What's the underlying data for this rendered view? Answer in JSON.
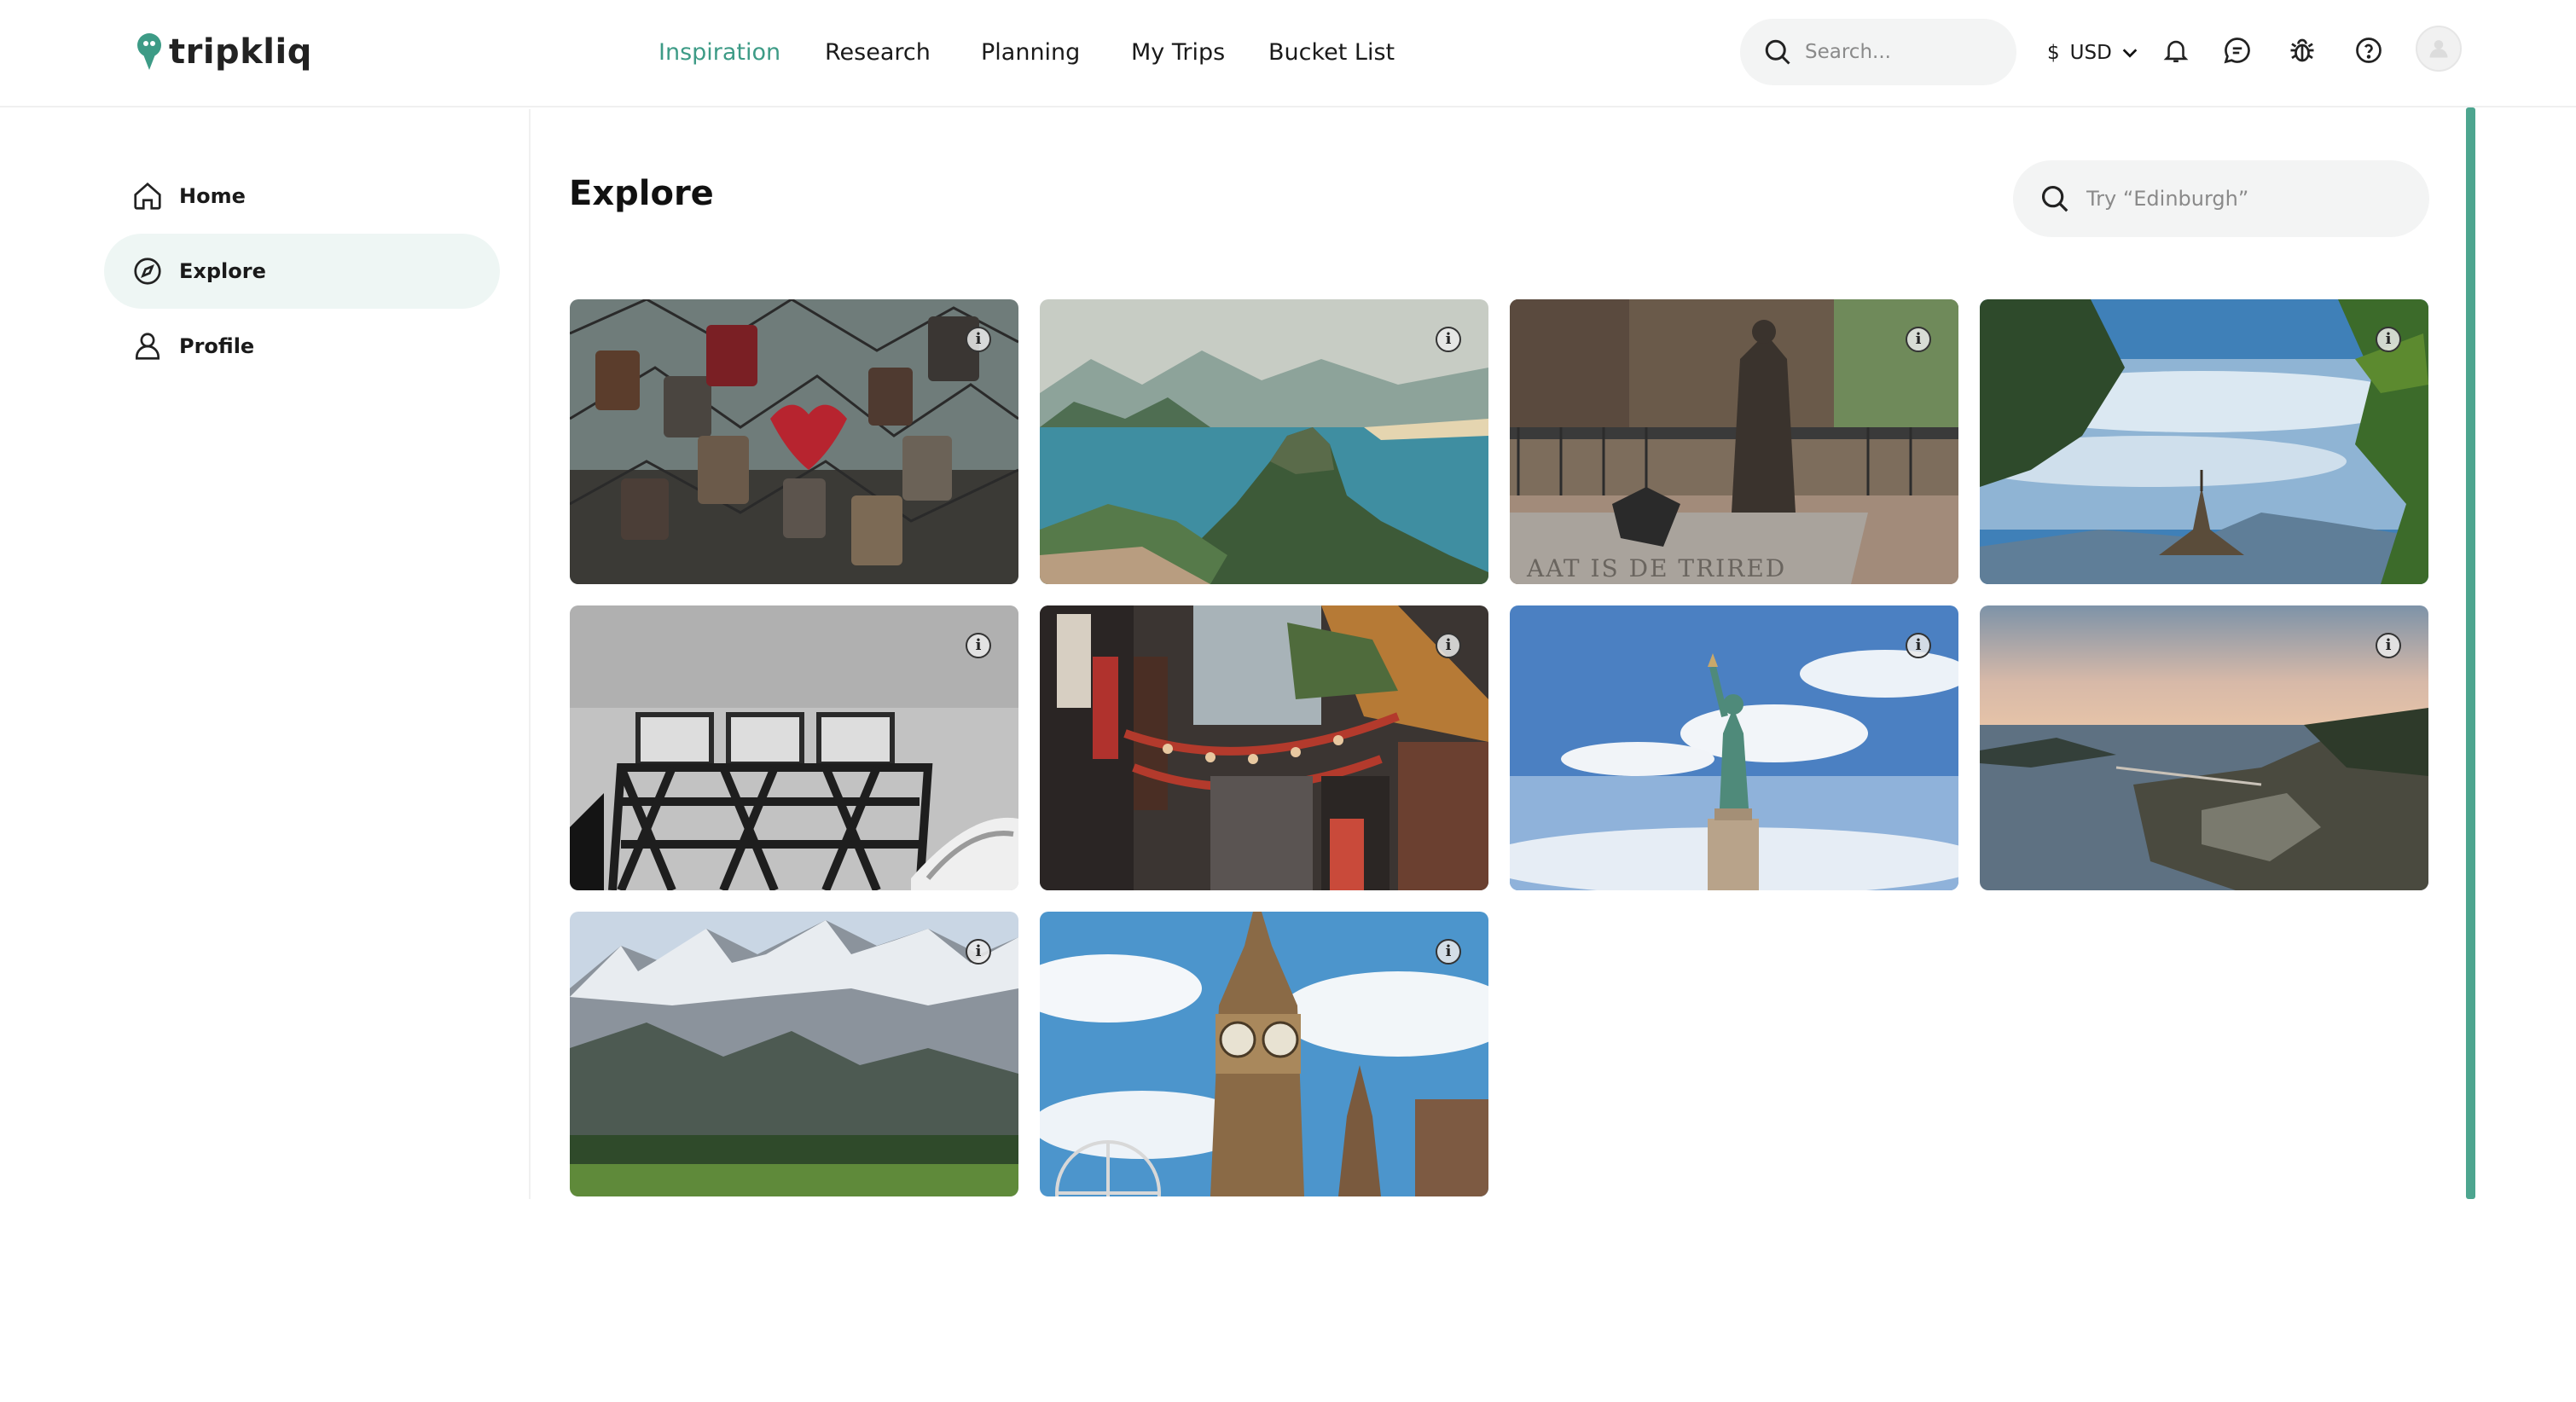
{
  "app": {
    "name": "tripkliq",
    "accent_color": "#3d9b86"
  },
  "header": {
    "nav": [
      {
        "label": "Inspiration",
        "active": true
      },
      {
        "label": "Research",
        "active": false
      },
      {
        "label": "Planning",
        "active": false
      },
      {
        "label": "My Trips",
        "active": false
      },
      {
        "label": "Bucket List",
        "active": false
      }
    ],
    "search_placeholder": "Search...",
    "currency_symbol": "$",
    "currency_code": "USD",
    "icons": [
      "bell-icon",
      "chat-icon",
      "bug-icon",
      "help-icon"
    ]
  },
  "sidebar": {
    "items": [
      {
        "label": "Home",
        "icon": "home-icon",
        "active": false
      },
      {
        "label": "Explore",
        "icon": "compass-icon",
        "active": true
      },
      {
        "label": "Profile",
        "icon": "user-icon",
        "active": false
      }
    ]
  },
  "main": {
    "title": "Explore",
    "search_placeholder": "Try “Edinburgh”",
    "cards": [
      {
        "scene": "love-locks",
        "info_icon": "info-icon"
      },
      {
        "scene": "sugarloaf-mountain",
        "info_icon": "info-icon"
      },
      {
        "scene": "canal-bridge-statue",
        "info_icon": "info-icon"
      },
      {
        "scene": "temple-on-hill",
        "info_icon": "info-icon"
      },
      {
        "scene": "bridge-sign",
        "info_icon": "info-icon"
      },
      {
        "scene": "chinatown-street",
        "info_icon": "info-icon"
      },
      {
        "scene": "statue-of-liberty",
        "info_icon": "info-icon"
      },
      {
        "scene": "coastal-sunset",
        "info_icon": "info-icon"
      },
      {
        "scene": "snowy-mountains",
        "info_icon": "info-icon"
      },
      {
        "scene": "big-ben",
        "info_icon": "info-icon"
      }
    ]
  }
}
